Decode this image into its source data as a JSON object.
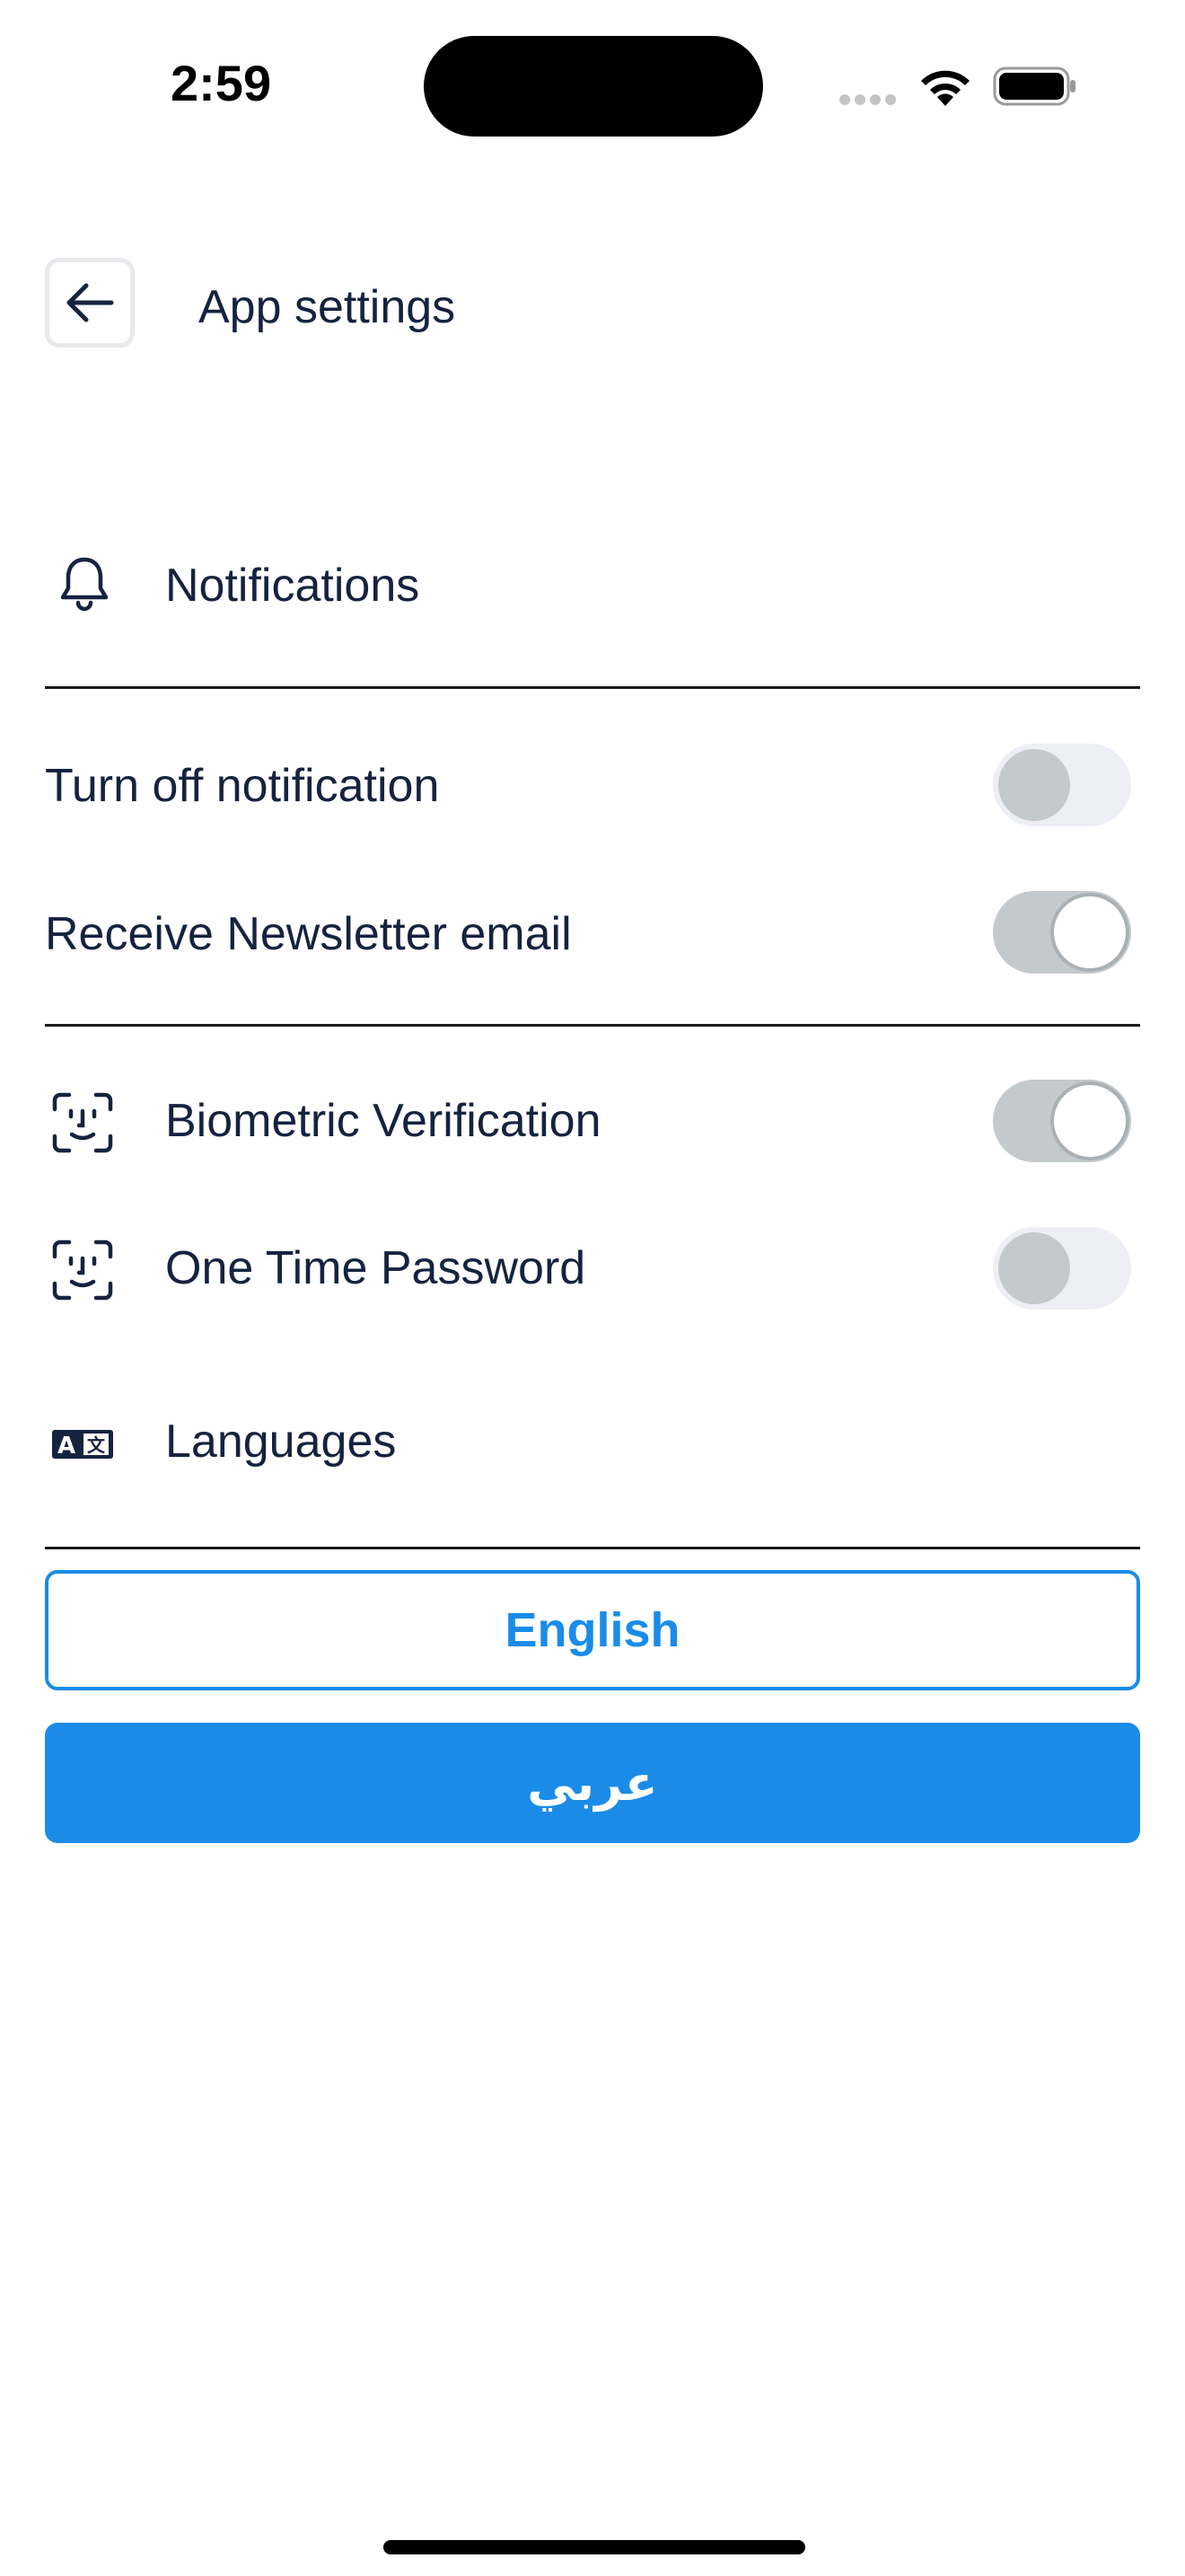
{
  "status_bar": {
    "time": "2:59"
  },
  "header": {
    "title": "App settings",
    "back_icon": "arrow-left-icon"
  },
  "sections": {
    "notifications": {
      "label": "Notifications",
      "icon": "bell-icon"
    },
    "languages": {
      "label": "Languages",
      "icon": "translate-icon"
    }
  },
  "settings": [
    {
      "label": "Turn off notification",
      "enabled": false
    },
    {
      "label": "Receive Newsletter email",
      "enabled": true
    },
    {
      "label": "Biometric Verification",
      "enabled": true,
      "icon": "face-id-icon"
    },
    {
      "label": "One Time Password",
      "enabled": false,
      "icon": "face-id-icon"
    }
  ],
  "language_options": {
    "english": "English",
    "arabic": "عربي",
    "selected": "English"
  },
  "colors": {
    "accent": "#1a8ce8",
    "text": "#15233f",
    "toggle_track_on": "#c4c9cc",
    "toggle_track_off": "#eeeef6"
  }
}
